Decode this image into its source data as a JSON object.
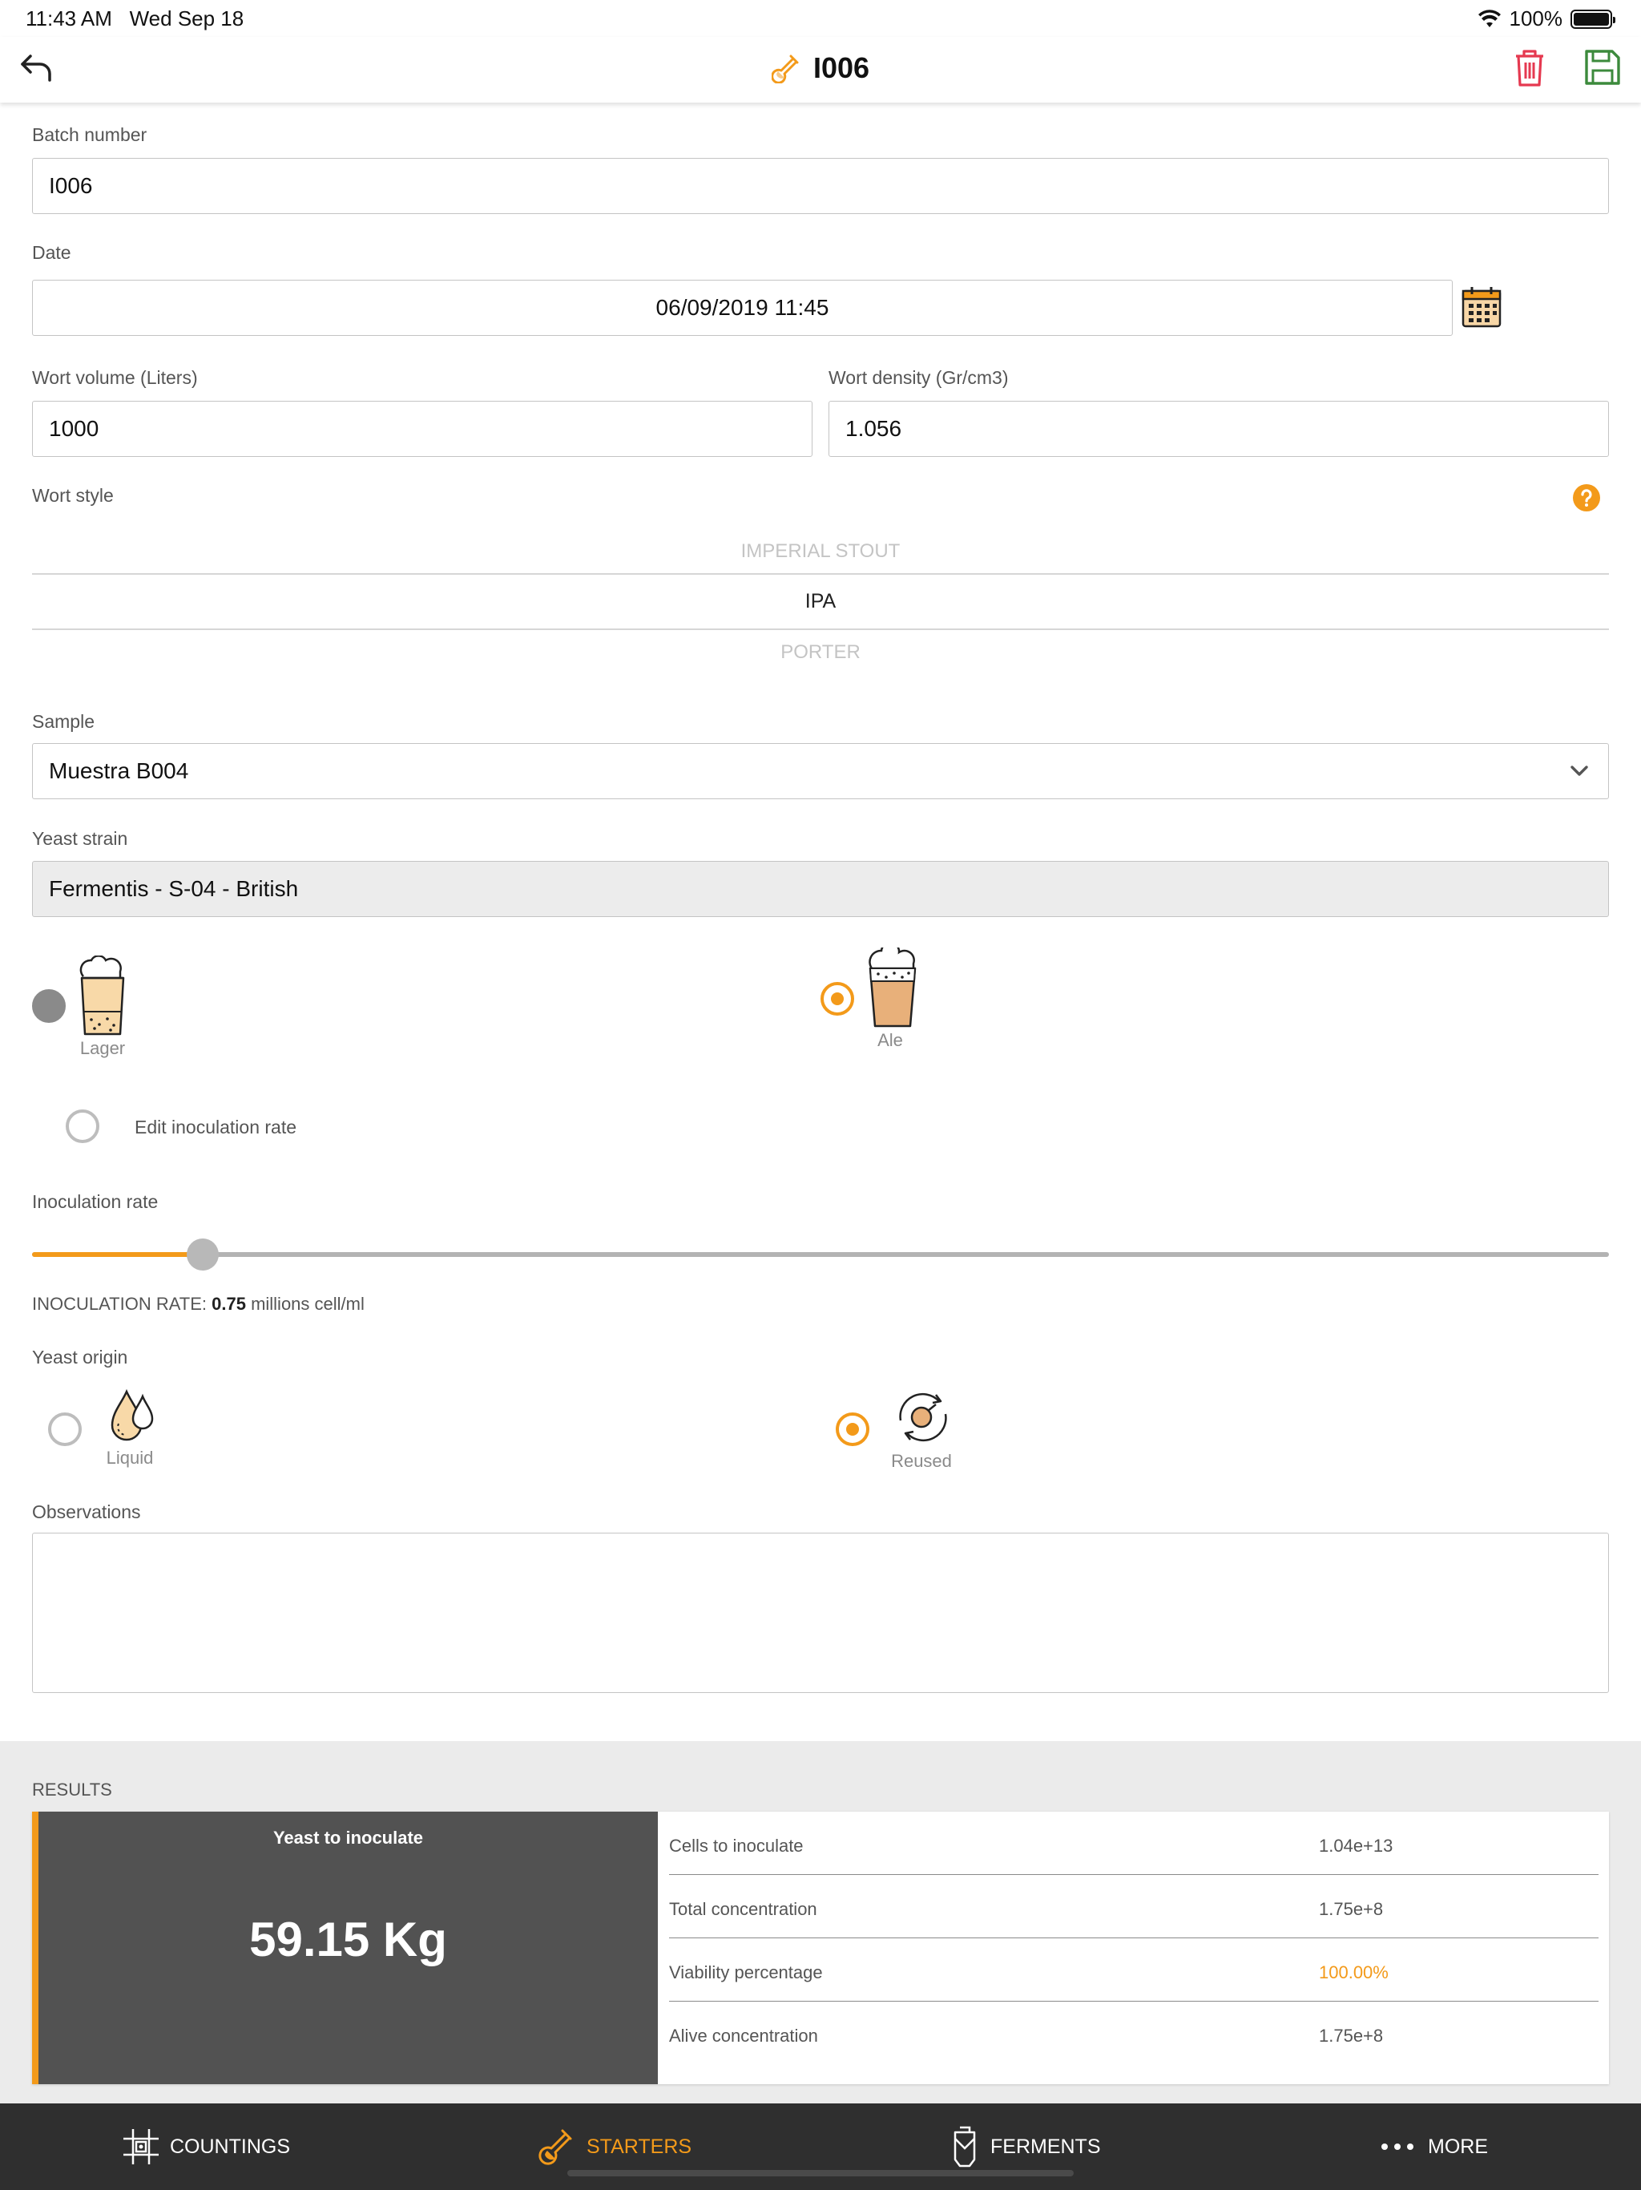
{
  "status_bar": {
    "time": "11:43 AM",
    "date": "Wed Sep 18",
    "battery": "100%"
  },
  "header": {
    "title": "I006",
    "back_icon": "back-arrow-icon",
    "delete_icon": "trash-icon",
    "save_icon": "save-icon"
  },
  "form": {
    "batch_number": {
      "label": "Batch number",
      "value": "I006"
    },
    "date": {
      "label": "Date",
      "value": "06/09/2019 11:45"
    },
    "wort_volume": {
      "label": "Wort volume (Liters)",
      "value": "1000"
    },
    "wort_density": {
      "label": "Wort density (Gr/cm3)",
      "value": "1.056"
    },
    "wort_style": {
      "label": "Wort style",
      "prev": "IMPERIAL STOUT",
      "selected": "IPA",
      "next": "PORTER"
    },
    "sample": {
      "label": "Sample",
      "value": "Muestra B004"
    },
    "yeast_strain": {
      "label": "Yeast strain",
      "value": "Fermentis - S-04 - British"
    },
    "fermentation_type": {
      "lager": "Lager",
      "ale": "Ale",
      "selected": "Ale"
    },
    "edit_inoculation": {
      "label": "Edit inoculation rate",
      "checked": false
    },
    "inoculation": {
      "label": "Inoculation rate",
      "slider_fraction": 0.108,
      "caption_prefix": "INOCULATION RATE:",
      "value": "0.75",
      "unit": "millions cell/ml"
    },
    "yeast_origin": {
      "label": "Yeast origin",
      "liquid": "Liquid",
      "reused": "Reused",
      "selected": "Reused"
    },
    "observations": {
      "label": "Observations",
      "value": ""
    }
  },
  "results": {
    "title": "RESULTS",
    "yeast_caption": "Yeast to inoculate",
    "yeast_value": "59.15 Kg",
    "rows": [
      {
        "key": "Cells to inoculate",
        "value": "1.04e+13"
      },
      {
        "key": "Total concentration",
        "value": "1.75e+8"
      },
      {
        "key": "Viability percentage",
        "value": "100.00%"
      },
      {
        "key": "Alive concentration",
        "value": "1.75e+8"
      }
    ]
  },
  "nav": {
    "items": [
      {
        "label": "COUNTINGS",
        "icon": "grid-icon"
      },
      {
        "label": "STARTERS",
        "icon": "flask-icon",
        "active": true
      },
      {
        "label": "FERMENTS",
        "icon": "fermenter-icon"
      },
      {
        "label": "MORE",
        "icon": "more-dots-icon"
      }
    ]
  },
  "colors": {
    "accent": "#f39a1a",
    "danger": "#e53950",
    "save": "#3c8a3c",
    "dark_panel": "#525252",
    "nav_bg": "#2f2f2f"
  }
}
